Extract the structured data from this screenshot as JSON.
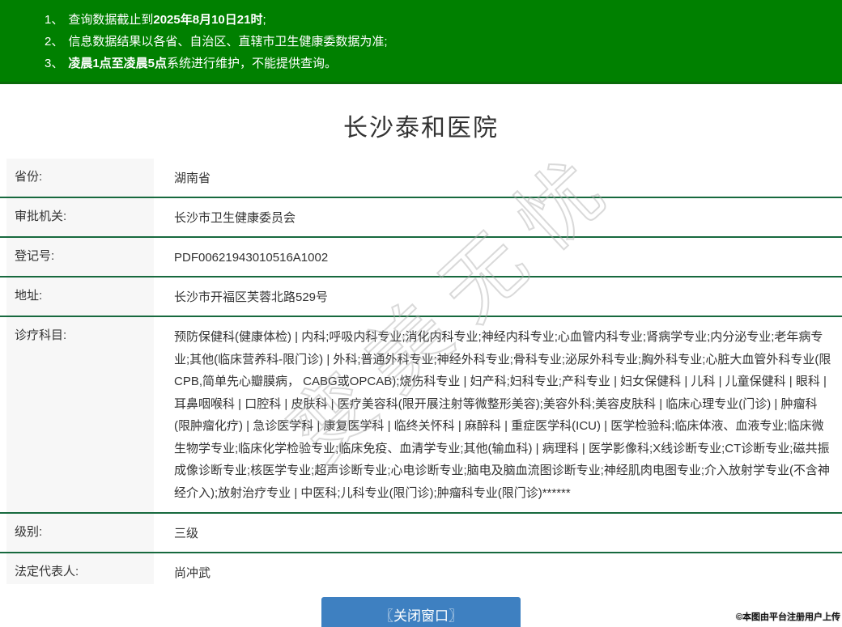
{
  "notice": {
    "items": [
      {
        "num": "1、",
        "segments": [
          {
            "t": "查询数据截止到",
            "b": false
          },
          {
            "t": "2025年8月10日21时",
            "b": true
          },
          {
            "t": ";",
            "b": false
          }
        ]
      },
      {
        "num": "2、",
        "segments": [
          {
            "t": "信息数据结果以各省、自治区、直辖市卫生健康委数据为准;",
            "b": false
          }
        ]
      },
      {
        "num": "3、",
        "segments": [
          {
            "t": "凌晨1点至凌晨5点",
            "b": true
          },
          {
            "t": "系统进行维护，不能提供查询。",
            "b": false
          }
        ]
      }
    ]
  },
  "page": {
    "title": "长沙泰和医院"
  },
  "details": {
    "rows": [
      {
        "label": "省份:",
        "value": "湖南省",
        "big": false
      },
      {
        "label": "审批机关:",
        "value": "长沙市卫生健康委员会",
        "big": false
      },
      {
        "label": "登记号:",
        "value": "PDF00621943010516A1002",
        "big": false
      },
      {
        "label": "地址:",
        "value": "长沙市开福区芙蓉北路529号",
        "big": false
      },
      {
        "label": "诊疗科目:",
        "value": "预防保健科(健康体检) | 内科;呼吸内科专业;消化内科专业;神经内科专业;心血管内科专业;肾病学专业;内分泌专业;老年病专业;其他(临床营养科-限门诊) | 外科;普通外科专业;神经外科专业;骨科专业;泌尿外科专业;胸外科专业;心脏大血管外科专业(限CPB,简单先心瓣膜病， CABG或OPCAB);烧伤科专业 | 妇产科;妇科专业;产科专业 | 妇女保健科 | 儿科 | 儿童保健科 | 眼科 | 耳鼻咽喉科 | 口腔科 | 皮肤科 | 医疗美容科(限开展注射等微整形美容);美容外科;美容皮肤科 | 临床心理专业(门诊) | 肿瘤科(限肿瘤化疗) | 急诊医学科 | 康复医学科 | 临终关怀科 | 麻醉科 | 重症医学科(ICU) | 医学检验科;临床体液、血液专业;临床微生物学专业;临床化学检验专业;临床免疫、血清学专业;其他(输血科) | 病理科 | 医学影像科;X线诊断专业;CT诊断专业;磁共振成像诊断专业;核医学专业;超声诊断专业;心电诊断专业;脑电及脑血流图诊断专业;神经肌肉电图专业;介入放射学专业(不含神经介入);放射治疗专业 | 中医科;儿科专业(限门诊);肿瘤科专业(限门诊)******",
        "big": true
      },
      {
        "label": "级别:",
        "value": "三级",
        "big": false
      },
      {
        "label": "法定代表人:",
        "value": "尚冲武",
        "big": false
      }
    ]
  },
  "watermark": {
    "text": "变美无忧"
  },
  "footer": {
    "close_button": "〖关闭窗口〗",
    "stamp": "©本图由平台注册用户上传"
  },
  "colors": {
    "banner_green": "#008000",
    "divider_green": "#17693e",
    "button_blue": "#3e80c1",
    "label_bg": "#f7f7f7"
  }
}
